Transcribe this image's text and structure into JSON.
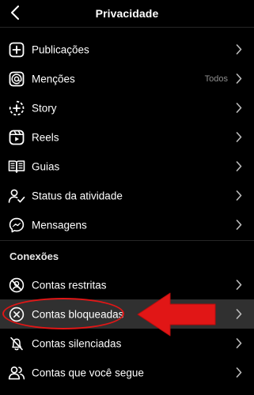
{
  "header": {
    "title": "Privacidade",
    "back_icon": "chevron-left-icon"
  },
  "items": [
    {
      "label": "Publicações",
      "icon": "plus-square-icon"
    },
    {
      "label": "Menções",
      "icon": "at-sign-icon",
      "value": "Todos"
    },
    {
      "label": "Story",
      "icon": "story-add-icon"
    },
    {
      "label": "Reels",
      "icon": "reels-icon"
    },
    {
      "label": "Guias",
      "icon": "guide-book-icon"
    },
    {
      "label": "Status da atividade",
      "icon": "activity-status-icon"
    },
    {
      "label": "Mensagens",
      "icon": "messenger-icon"
    }
  ],
  "section": {
    "title": "Conexões"
  },
  "connections": [
    {
      "label": "Contas restritas",
      "icon": "restricted-icon"
    },
    {
      "label": "Contas bloqueadas",
      "icon": "blocked-icon"
    },
    {
      "label": "Contas silenciadas",
      "icon": "muted-bell-icon"
    },
    {
      "label": "Contas que você segue",
      "icon": "following-icon"
    }
  ],
  "colors": {
    "background": "#000000",
    "text": "#ffffff",
    "secondary_text": "#8e8e8e",
    "highlight_row": "#303030",
    "callout_red": "#e11616"
  }
}
